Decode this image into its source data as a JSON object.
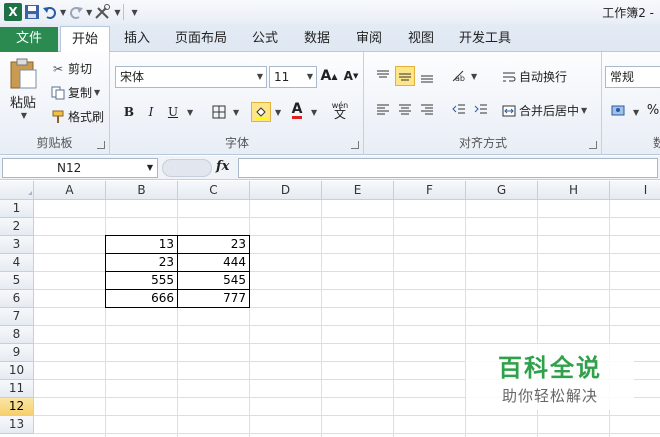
{
  "window": {
    "title": "工作簿2 -"
  },
  "tabs": [
    {
      "label": "文件"
    },
    {
      "label": "开始"
    },
    {
      "label": "插入"
    },
    {
      "label": "页面布局"
    },
    {
      "label": "公式"
    },
    {
      "label": "数据"
    },
    {
      "label": "审阅"
    },
    {
      "label": "视图"
    },
    {
      "label": "开发工具"
    }
  ],
  "ribbon": {
    "clipboard": {
      "label": "剪贴板",
      "paste": "粘贴",
      "cut": "剪切",
      "copy": "复制",
      "format_painter": "格式刷"
    },
    "font": {
      "label": "字体",
      "name": "宋体",
      "size": "11"
    },
    "alignment": {
      "label": "对齐方式",
      "wrap": "自动换行",
      "merge": "合并后居中"
    },
    "number": {
      "label": "数",
      "format": "常规"
    }
  },
  "formula_bar": {
    "name_box": "N12",
    "fx": "fx"
  },
  "sheet": {
    "columns": [
      "A",
      "B",
      "C",
      "D",
      "E",
      "F",
      "G",
      "H",
      "I"
    ],
    "rows": [
      "1",
      "2",
      "3",
      "4",
      "5",
      "6",
      "7",
      "8",
      "9",
      "10",
      "11",
      "12",
      "13"
    ],
    "selected_row": "12",
    "cells": [
      {
        "ref": "B3",
        "value": "13"
      },
      {
        "ref": "C3",
        "value": "23"
      },
      {
        "ref": "B4",
        "value": "23"
      },
      {
        "ref": "C4",
        "value": "444"
      },
      {
        "ref": "B5",
        "value": "555"
      },
      {
        "ref": "C5",
        "value": "545"
      },
      {
        "ref": "B6",
        "value": "666"
      },
      {
        "ref": "C6",
        "value": "777"
      }
    ]
  },
  "watermark": {
    "title": "百科全说",
    "subtitle": "助你轻松解决"
  }
}
